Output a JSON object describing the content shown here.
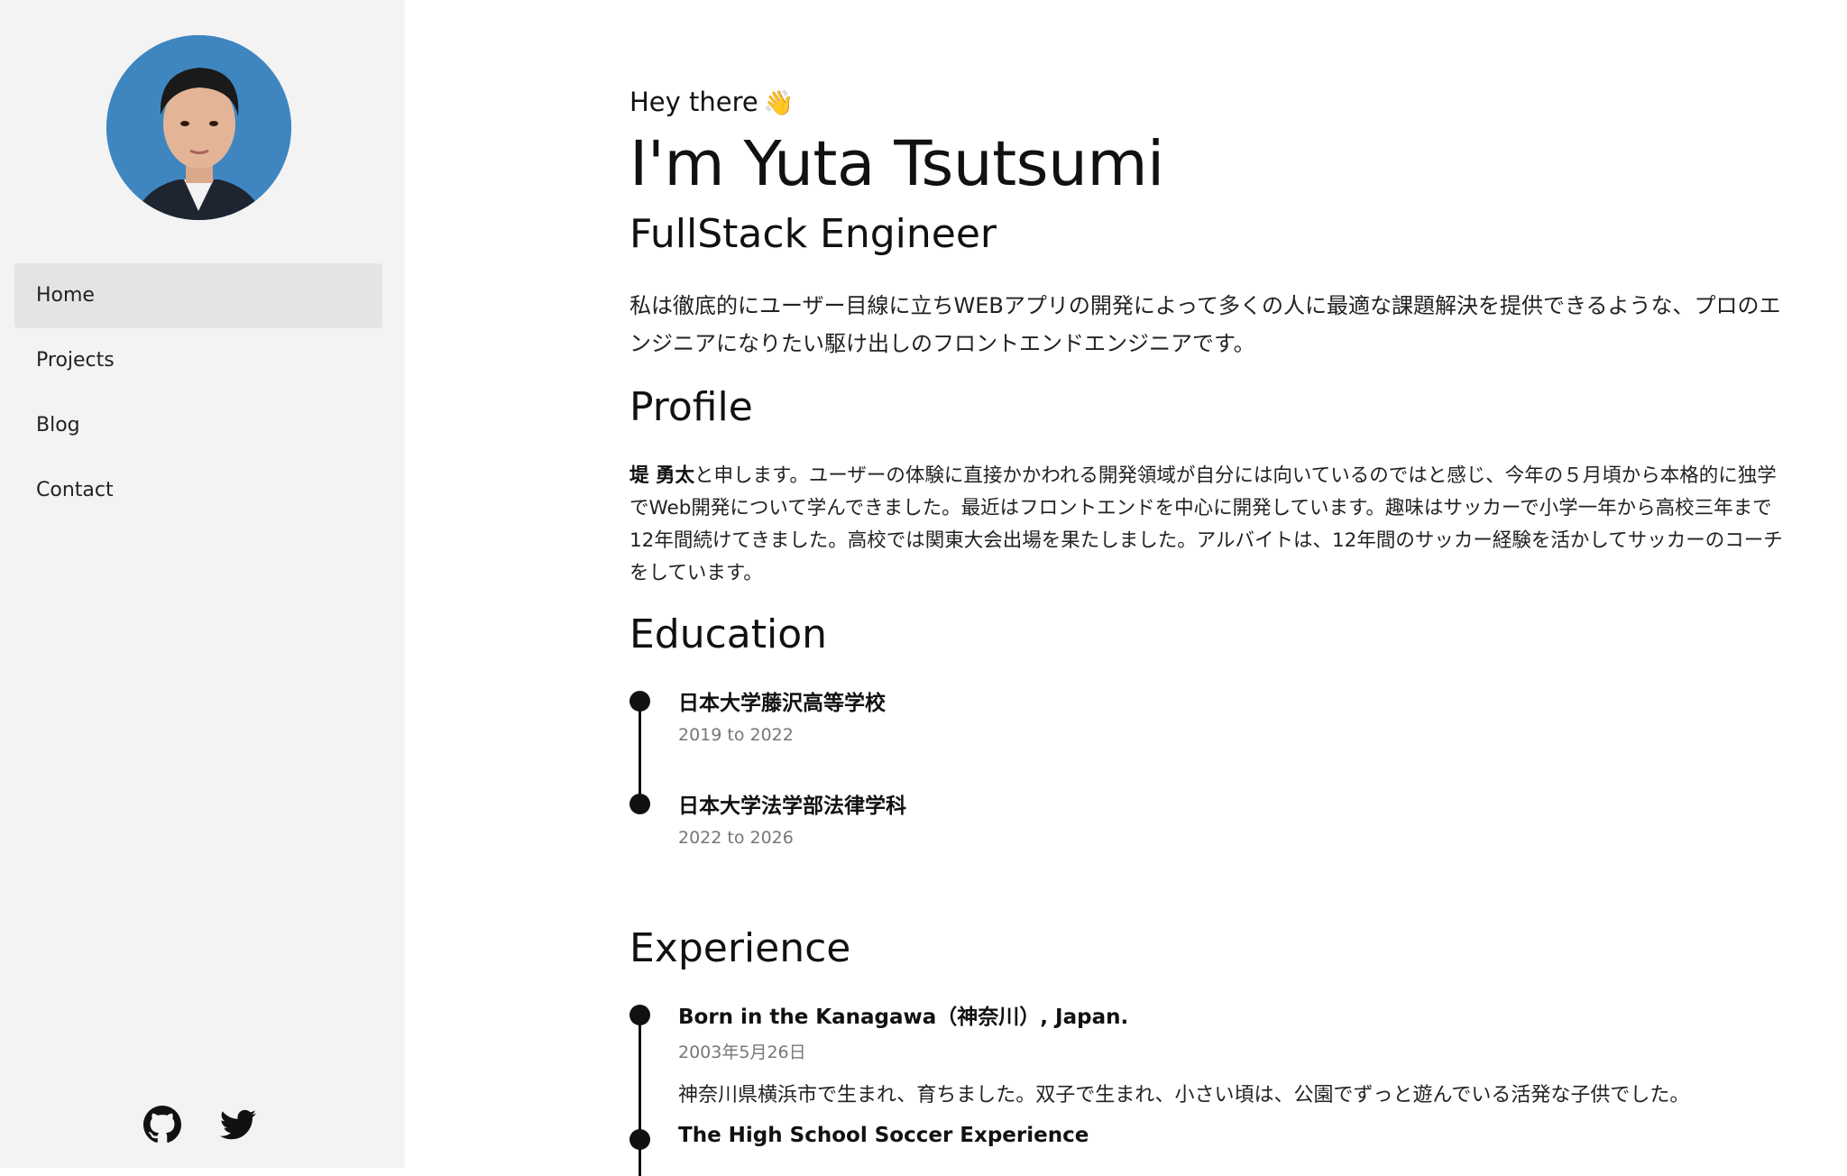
{
  "sidebar": {
    "nav": [
      {
        "label": "Home",
        "active": true
      },
      {
        "label": "Projects",
        "active": false
      },
      {
        "label": "Blog",
        "active": false
      },
      {
        "label": "Contact",
        "active": false
      }
    ],
    "social": [
      {
        "icon": "github-icon"
      },
      {
        "icon": "twitter-icon"
      }
    ]
  },
  "hero": {
    "greeting": "Hey there",
    "wave": "👋",
    "name": "I'm Yuta Tsutsumi",
    "role": "FullStack Engineer",
    "intro": "私は徹底的にユーザー目線に立ちWEBアプリの開発によって多くの人に最適な課題解決を提供できるような、プロのエンジニアになりたい駆け出しのフロントエンドエンジニアです。"
  },
  "profile": {
    "title": "Profile",
    "name_bold": "堤 勇太",
    "text": "と申します。ユーザーの体験に直接かかわれる開発領域が自分には向いているのではと感じ、今年の５月頃から本格的に独学でWeb開発について学んできました。最近はフロントエンドを中心に開発しています。趣味はサッカーで小学一年から高校三年まで12年間続けてきました。高校では関東大会出場を果たしました。アルバイトは、12年間のサッカー経験を活かしてサッカーのコーチをしています。"
  },
  "education": {
    "title": "Education",
    "items": [
      {
        "title": "日本大学藤沢高等学校",
        "date": "2019 to 2022"
      },
      {
        "title": "日本大学法学部法律学科",
        "date": "2022 to 2026"
      }
    ]
  },
  "experience": {
    "title": "Experience",
    "items": [
      {
        "title": "Born in the Kanagawa（神奈川）, Japan.",
        "date": "2003年5月26日",
        "desc": "神奈川県横浜市で生まれ、育ちました。双子で生まれ、小さい頃は、公園でずっと遊んでいる活発な子供でした。"
      },
      {
        "title": "The High School Soccer Experience"
      }
    ]
  }
}
